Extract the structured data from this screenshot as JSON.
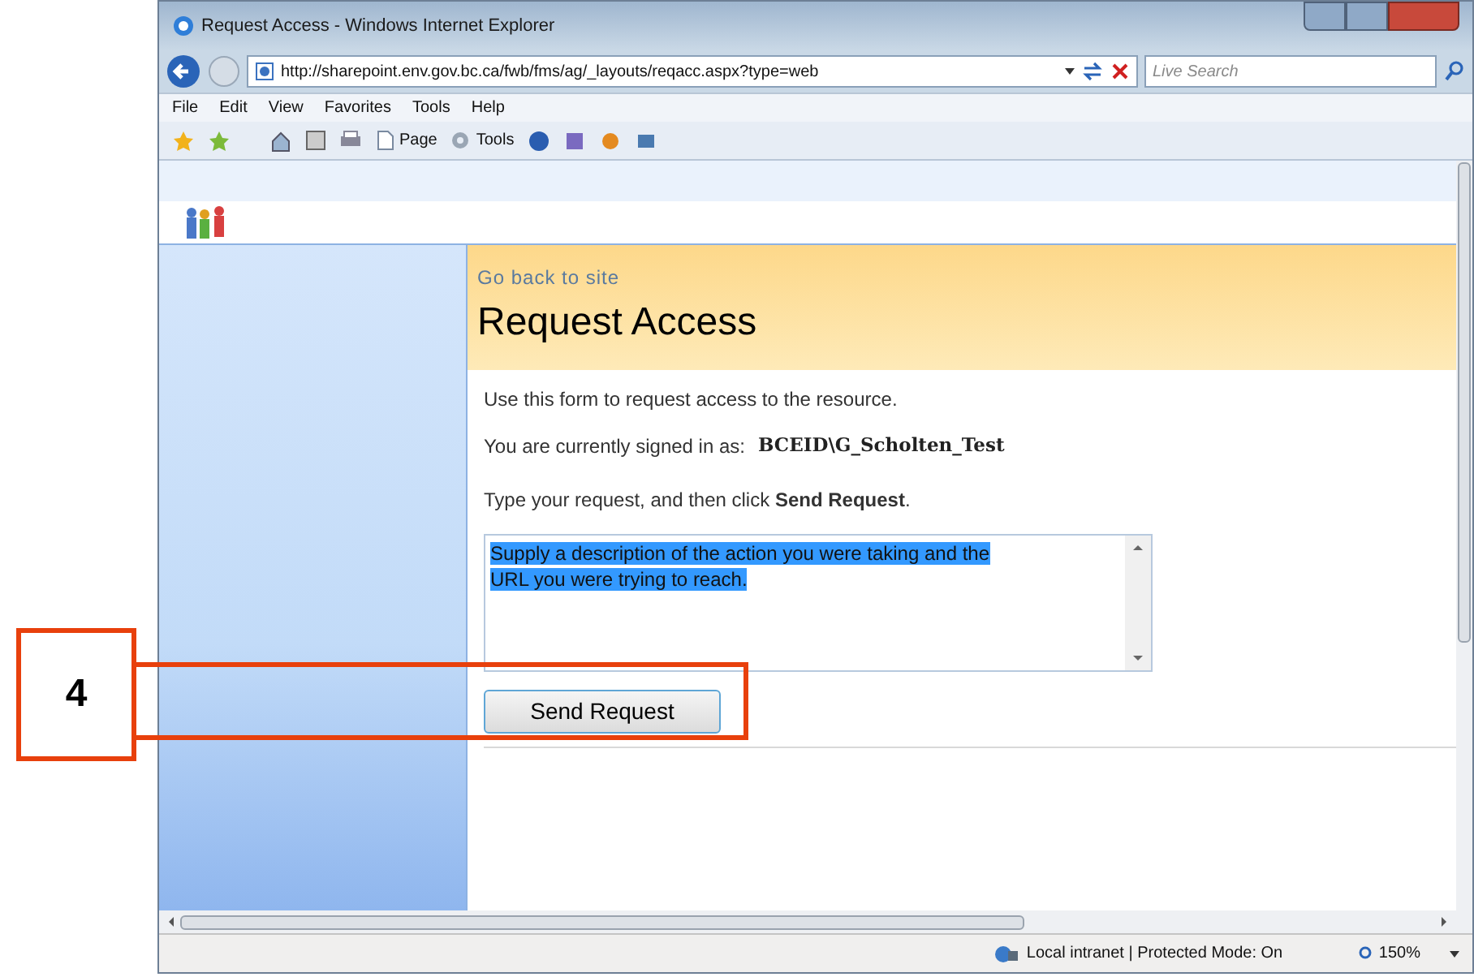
{
  "window": {
    "title": "Request Access - Windows Internet Explorer"
  },
  "address_bar": {
    "url": "http://sharepoint.env.gov.bc.ca/fwb/fms/ag/_layouts/reqacc.aspx?type=web"
  },
  "search": {
    "placeholder": "Live Search"
  },
  "menu": [
    "File",
    "Edit",
    "View",
    "Favorites",
    "Tools",
    "Help"
  ],
  "toolbar": [
    "Page",
    "Tools"
  ],
  "page": {
    "back_link": "Go back to site",
    "heading": "Request Access",
    "intro": "Use this form to request access to the resource.",
    "signed_in_label": "You are currently signed in as:",
    "user": "BCEID\\G_Scholten_Test",
    "instruction": "Type your request, and then click **Send Request**.",
    "request": {
      "value": "Supply a description of the action you were taking and the URL you were trying to reach.",
      "selected": true
    },
    "button": "Send Request"
  },
  "status_bar": {
    "zone": "Local intranet | Protected Mode: On",
    "zoom": "150%"
  },
  "annotation": {
    "label": "4"
  }
}
